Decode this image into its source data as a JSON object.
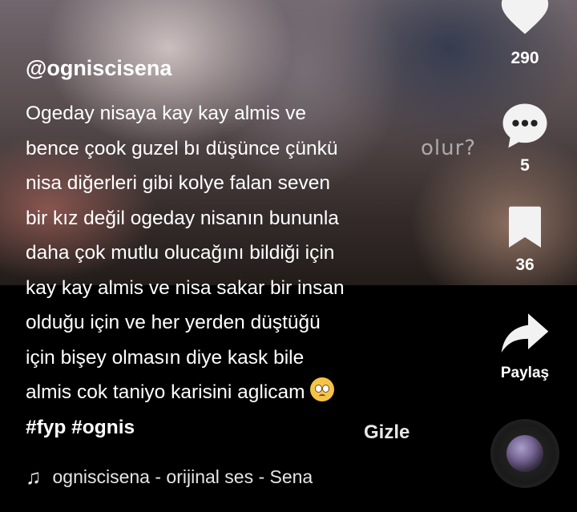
{
  "video": {
    "overlay_text": "olur?"
  },
  "author": {
    "username": "@ogniscisena"
  },
  "caption": {
    "lines": [
      "Ogeday nisaya kay kay almis ve",
      "bence çook guzel bı düşünce çünkü",
      "nisa diğerleri gibi kolye falan seven",
      "bir kız değil ogeday nisanın bununla",
      "daha çok mutlu olucağını bildiği için",
      "kay kay almis ve nisa sakar bir insan",
      "olduğu için ve her yerden düştüğü",
      "için bişey olmasın diye kask bile",
      "almis cok taniyo karisini aglicam"
    ],
    "hashtags": "#fyp #ognis"
  },
  "actions": {
    "like_count": "290",
    "comment_count": "5",
    "bookmark_count": "36",
    "share_label": "Paylaş",
    "hide_label": "Gizle"
  },
  "sound": {
    "label": "ogniscisena - orijinal ses - Sena"
  },
  "icons": {
    "like": "heart-icon",
    "comment": "comment-bubble-icon",
    "bookmark": "bookmark-icon",
    "share": "share-arrow-icon",
    "music": "music-note-icon",
    "emoji": "pleading-face-emoji"
  },
  "colors": {
    "background": "#000000",
    "text": "#ffffff",
    "icon": "#f2f2f2"
  }
}
